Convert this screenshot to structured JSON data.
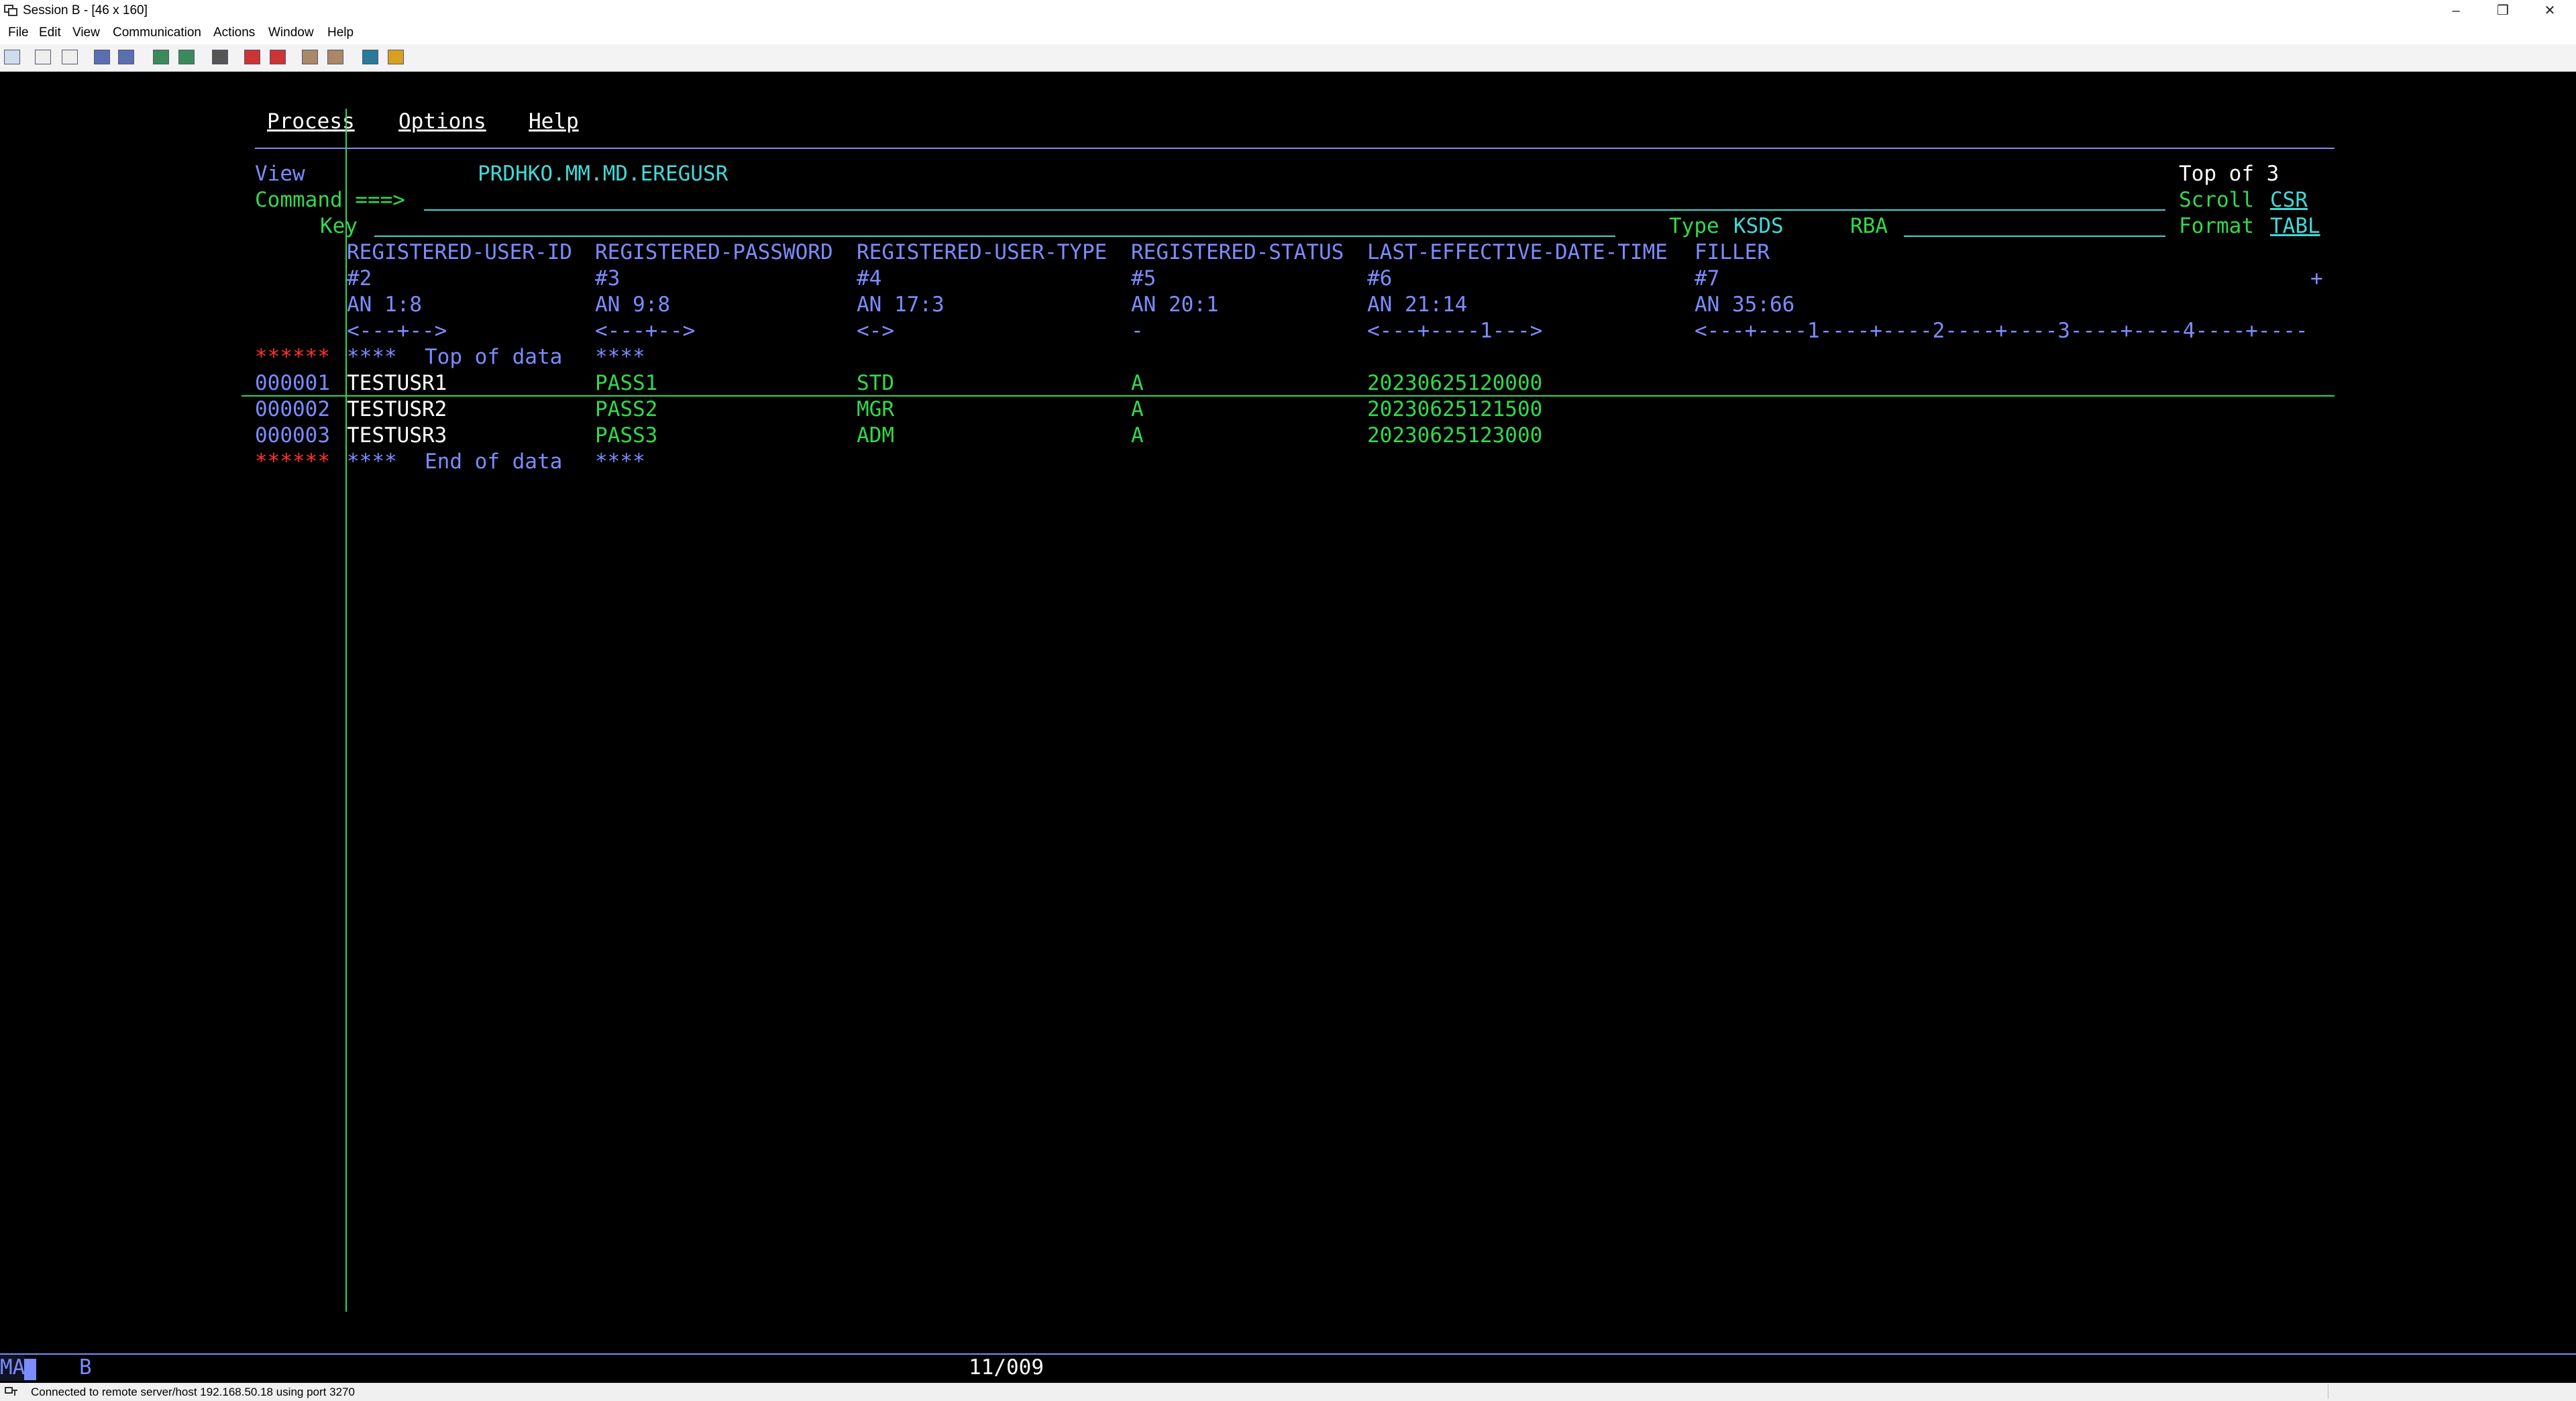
{
  "window": {
    "title": "Session B - [46 x 160]",
    "controls": {
      "minimize": "–",
      "restore": "❐",
      "close": "✕"
    }
  },
  "menubar": [
    "File",
    "Edit",
    "View",
    "Communication",
    "Actions",
    "Window",
    "Help"
  ],
  "toolbar_icons": [
    "display-icon",
    "copy-icon",
    "paste-icon",
    "send-icon",
    "receive-icon",
    "macro-icon",
    "keypad-icon",
    "print-icon",
    "record-icon",
    "stop-icon",
    "play-icon",
    "transfer-icon",
    "map-icon",
    "tool-icon"
  ],
  "screen": {
    "action_bar": [
      "Process",
      "Options",
      "Help"
    ],
    "mode": "View",
    "dataset": "PRDHKO.MM.MD.EREGUSR",
    "position": "Top of 3",
    "command_label": "Command ===>",
    "command_value": "",
    "scroll_label": "Scroll",
    "scroll_value": "CSR",
    "key_label": "Key",
    "type_label": "Type",
    "type_value": "KSDS",
    "rba_label": "RBA",
    "format_label": "Format",
    "format_value": "TABL",
    "columns": [
      {
        "name": "REGISTERED-USER-ID",
        "num": "#2",
        "attr": "AN 1:8",
        "ruler": "<---+-->"
      },
      {
        "name": "REGISTERED-PASSWORD",
        "num": "#3",
        "attr": "AN 9:8",
        "ruler": "<---+-->"
      },
      {
        "name": "REGISTERED-USER-TYPE",
        "num": "#4",
        "attr": "AN 17:3",
        "ruler": "<->"
      },
      {
        "name": "REGISTERED-STATUS",
        "num": "#5",
        "attr": "AN 20:1",
        "ruler": "-"
      },
      {
        "name": "LAST-EFFECTIVE-DATE-TIME",
        "num": "#6",
        "attr": "AN 21:14",
        "ruler": "<---+----1--->"
      },
      {
        "name": "FILLER",
        "num": "#7",
        "attr": "AN 35:66",
        "ruler": "<---+----1----+----2----+----3----+----4----+----"
      }
    ],
    "more_indicator": "+",
    "top_marker": {
      "prefix": "******",
      "stars": "****",
      "text": "Top of data",
      "stars2": "****"
    },
    "rows": [
      {
        "line": "000001",
        "cells": [
          "TESTUSR1",
          "PASS1",
          "STD",
          "A",
          "20230625120000"
        ]
      },
      {
        "line": "000002",
        "cells": [
          "TESTUSR2",
          "PASS2",
          "MGR",
          "A",
          "20230625121500"
        ]
      },
      {
        "line": "000003",
        "cells": [
          "TESTUSR3",
          "PASS3",
          "ADM",
          "A",
          "20230625123000"
        ]
      }
    ],
    "end_marker": {
      "prefix": "******",
      "stars": "****",
      "text": "End of data",
      "stars2": "****"
    }
  },
  "oia": {
    "left": "MA",
    "session": "B",
    "cursor": "11/009"
  },
  "status": "Connected to remote server/host 192.168.50.18 using port 3270"
}
